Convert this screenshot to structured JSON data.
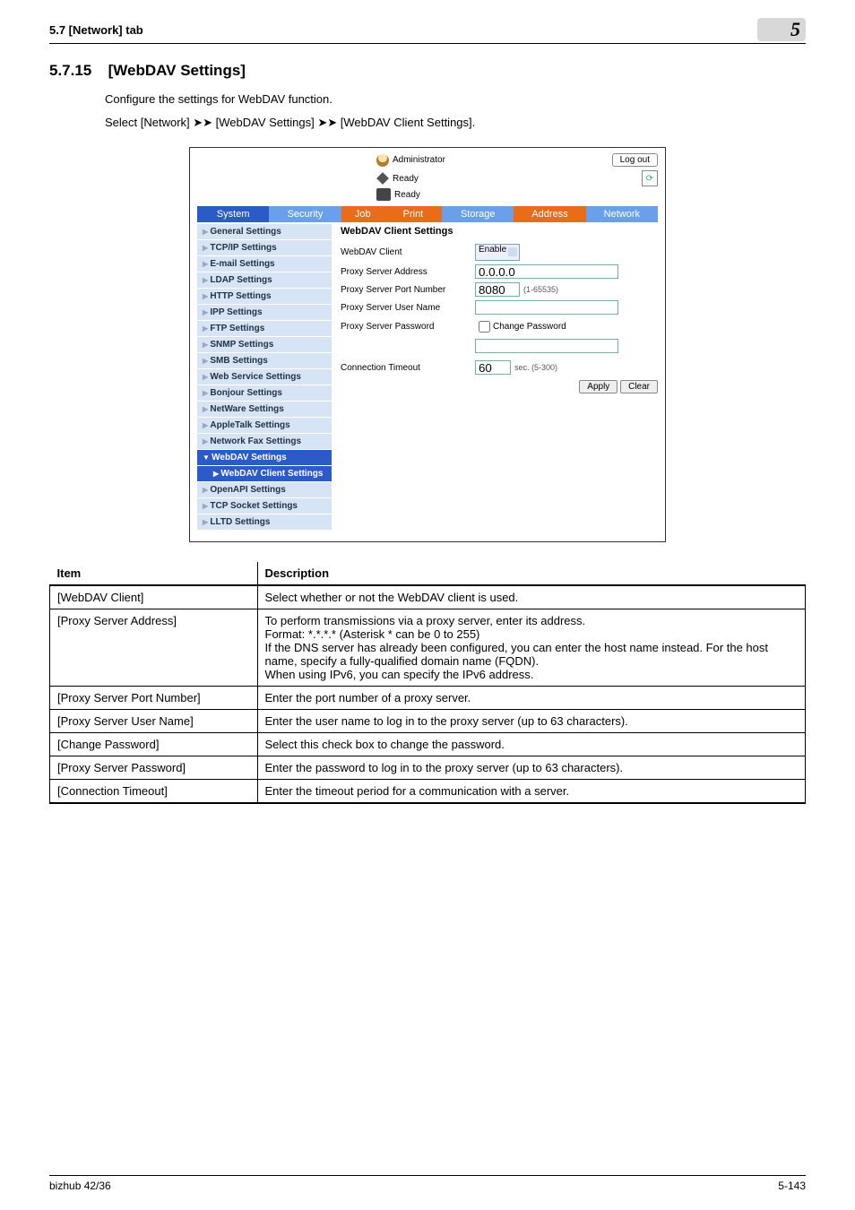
{
  "header": {
    "crumb": "5.7     [Network] tab",
    "chapter": "5"
  },
  "section": {
    "num": "5.7.15",
    "title": "[WebDAV Settings]"
  },
  "intro": {
    "line1": "Configure the settings for WebDAV function.",
    "line2": "Select [Network] ➤➤ [WebDAV Settings] ➤➤ [WebDAV Client Settings]."
  },
  "shot": {
    "admin": "Administrator",
    "logout": "Log out",
    "ready1": "Ready",
    "ready2": "Ready",
    "tabs": [
      "System",
      "Security",
      "Job",
      "Print",
      "Storage",
      "Address",
      "Network"
    ],
    "side": [
      {
        "t": "General Settings",
        "c": "lvl1"
      },
      {
        "t": "TCP/IP Settings",
        "c": "lvl1"
      },
      {
        "t": "E-mail Settings",
        "c": "lvl1"
      },
      {
        "t": "LDAP Settings",
        "c": "lvl1"
      },
      {
        "t": "HTTP Settings",
        "c": "lvl1"
      },
      {
        "t": "IPP Settings",
        "c": "lvl1"
      },
      {
        "t": "FTP Settings",
        "c": "lvl1"
      },
      {
        "t": "SNMP Settings",
        "c": "lvl1"
      },
      {
        "t": "SMB Settings",
        "c": "lvl1"
      },
      {
        "t": "Web Service Settings",
        "c": "lvl1"
      },
      {
        "t": "Bonjour Settings",
        "c": "lvl1"
      },
      {
        "t": "NetWare Settings",
        "c": "lvl1"
      },
      {
        "t": "AppleTalk Settings",
        "c": "lvl1"
      },
      {
        "t": "Network Fax Settings",
        "c": "lvl1"
      },
      {
        "t": "WebDAV Settings",
        "c": "active"
      },
      {
        "t": "WebDAV Client Settings",
        "c": "sub"
      },
      {
        "t": "OpenAPI Settings",
        "c": "lvl1"
      },
      {
        "t": "TCP Socket Settings",
        "c": "lvl1"
      },
      {
        "t": "LLTD Settings",
        "c": "lvl1"
      }
    ],
    "panel": {
      "title": "WebDAV Client Settings",
      "rows": {
        "client": {
          "l": "WebDAV Client",
          "v": "Enable"
        },
        "addr": {
          "l": "Proxy Server Address",
          "v": "0.0.0.0"
        },
        "port": {
          "l": "Proxy Server Port Number",
          "v": "8080",
          "hint": "(1-65535)"
        },
        "user": {
          "l": "Proxy Server User Name",
          "v": ""
        },
        "pass": {
          "l": "Proxy Server Password",
          "cb": "Change Password"
        },
        "passv": {
          "v": ""
        },
        "tout": {
          "l": "Connection Timeout",
          "v": "60",
          "hint": "sec. (5-300)"
        }
      },
      "apply": "Apply",
      "clear": "Clear"
    }
  },
  "table": {
    "h1": "Item",
    "h2": "Description",
    "rows": [
      {
        "a": "[WebDAV Client]",
        "b": "Select whether or not the WebDAV client is used."
      },
      {
        "a": "[Proxy Server Address]",
        "b": "To perform transmissions via a proxy server, enter its address.\nFormat: *.*.*.* (Asterisk * can be 0 to 255)\nIf the DNS server has already been configured, you can enter the host name instead. For the host name, specify a fully-qualified domain name (FQDN).\nWhen using IPv6, you can specify the IPv6 address."
      },
      {
        "a": "[Proxy Server Port Number]",
        "b": "Enter the port number of a proxy server."
      },
      {
        "a": "[Proxy Server User Name]",
        "b": "Enter the user name to log in to the proxy server (up to 63 characters)."
      },
      {
        "a": "[Change Password]",
        "b": "Select this check box to change the password."
      },
      {
        "a": "[Proxy Server Password]",
        "b": "Enter the password to log in to the proxy server (up to 63 characters)."
      },
      {
        "a": "[Connection Timeout]",
        "b": "Enter the timeout period for a communication with a server."
      }
    ]
  },
  "footer": {
    "left": "bizhub 42/36",
    "right": "5-143"
  }
}
